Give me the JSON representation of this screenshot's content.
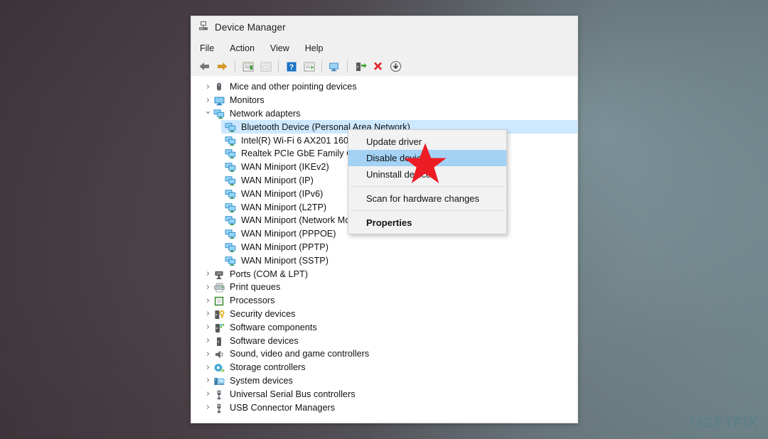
{
  "window": {
    "title": "Device Manager",
    "app_icon": "device-manager-icon",
    "menubar": [
      "File",
      "Action",
      "View",
      "Help"
    ],
    "toolbar": [
      {
        "name": "back-icon",
        "label": "Back"
      },
      {
        "name": "forward-icon",
        "label": "Forward"
      },
      {
        "name": "separator",
        "label": ""
      },
      {
        "name": "properties-icon",
        "label": "Properties"
      },
      {
        "name": "show-hidden-devices-icon",
        "label": "Show hidden devices"
      },
      {
        "name": "separator",
        "label": ""
      },
      {
        "name": "help-icon",
        "label": "Help"
      },
      {
        "name": "update-driver-icon",
        "label": "Update driver"
      },
      {
        "name": "scan-for-hardware-changes-icon",
        "label": "Scan for hardware changes"
      },
      {
        "name": "separator",
        "label": ""
      },
      {
        "name": "enable-device-icon",
        "label": "Enable device"
      },
      {
        "name": "uninstall-device-icon",
        "label": "Uninstall device"
      },
      {
        "name": "disable-device-icon",
        "label": "Disable device"
      }
    ]
  },
  "tree": [
    {
      "label": "Mice and other pointing devices",
      "icon": "mouse-icon",
      "state": "collapsed",
      "level": 1
    },
    {
      "label": "Monitors",
      "icon": "monitor-icon",
      "state": "collapsed",
      "level": 1
    },
    {
      "label": "Network adapters",
      "icon": "network-adapter-icon",
      "state": "expanded",
      "level": 1
    },
    {
      "label": "Bluetooth Device (Personal Area Network)",
      "icon": "network-adapter-icon",
      "state": "leaf",
      "level": 2,
      "selected": true
    },
    {
      "label": "Intel(R) Wi-Fi 6 AX201 160MHz",
      "icon": "network-adapter-icon",
      "state": "leaf",
      "level": 2
    },
    {
      "label": "Realtek PCIe GbE Family Controller",
      "icon": "network-adapter-icon",
      "state": "leaf",
      "level": 2
    },
    {
      "label": "WAN Miniport (IKEv2)",
      "icon": "network-adapter-icon",
      "state": "leaf",
      "level": 2
    },
    {
      "label": "WAN Miniport (IP)",
      "icon": "network-adapter-icon",
      "state": "leaf",
      "level": 2
    },
    {
      "label": "WAN Miniport (IPv6)",
      "icon": "network-adapter-icon",
      "state": "leaf",
      "level": 2
    },
    {
      "label": "WAN Miniport (L2TP)",
      "icon": "network-adapter-icon",
      "state": "leaf",
      "level": 2
    },
    {
      "label": "WAN Miniport (Network Monitor)",
      "icon": "network-adapter-icon",
      "state": "leaf",
      "level": 2
    },
    {
      "label": "WAN Miniport (PPPOE)",
      "icon": "network-adapter-icon",
      "state": "leaf",
      "level": 2
    },
    {
      "label": "WAN Miniport (PPTP)",
      "icon": "network-adapter-icon",
      "state": "leaf",
      "level": 2
    },
    {
      "label": "WAN Miniport (SSTP)",
      "icon": "network-adapter-icon",
      "state": "leaf",
      "level": 2
    },
    {
      "label": "Ports (COM & LPT)",
      "icon": "port-icon",
      "state": "collapsed",
      "level": 1
    },
    {
      "label": "Print queues",
      "icon": "printer-icon",
      "state": "collapsed",
      "level": 1
    },
    {
      "label": "Processors",
      "icon": "processor-icon",
      "state": "collapsed",
      "level": 1
    },
    {
      "label": "Security devices",
      "icon": "security-device-icon",
      "state": "collapsed",
      "level": 1
    },
    {
      "label": "Software components",
      "icon": "software-component-icon",
      "state": "collapsed",
      "level": 1
    },
    {
      "label": "Software devices",
      "icon": "software-device-icon",
      "state": "collapsed",
      "level": 1
    },
    {
      "label": "Sound, video and game controllers",
      "icon": "speaker-icon",
      "state": "collapsed",
      "level": 1
    },
    {
      "label": "Storage controllers",
      "icon": "storage-controller-icon",
      "state": "collapsed",
      "level": 1
    },
    {
      "label": "System devices",
      "icon": "system-device-icon",
      "state": "collapsed",
      "level": 1
    },
    {
      "label": "Universal Serial Bus controllers",
      "icon": "usb-icon",
      "state": "collapsed",
      "level": 1
    },
    {
      "label": "USB Connector Managers",
      "icon": "usb-icon",
      "state": "collapsed",
      "level": 1
    }
  ],
  "context_menu": {
    "items": [
      {
        "label": "Update driver",
        "highlighted": false,
        "bold": false
      },
      {
        "label": "Disable device",
        "highlighted": true,
        "bold": false
      },
      {
        "label": "Uninstall device",
        "highlighted": false,
        "bold": false
      },
      {
        "separator": true
      },
      {
        "label": "Scan for hardware changes",
        "highlighted": false,
        "bold": false
      },
      {
        "separator": true
      },
      {
        "label": "Properties",
        "highlighted": false,
        "bold": true
      }
    ]
  },
  "annotation": {
    "shape": "red-star",
    "color": "#ee1c25",
    "points_to": "Disable device"
  },
  "watermark": {
    "text_before": "UG",
    "text_mid": "E",
    "text_after": "TFIX",
    "full": "UGETFIX",
    "color": "#5d7f88"
  },
  "colors": {
    "selection_blue": "#cde8ff",
    "menu_highlight": "#a3d2f5",
    "star_red": "#ee1c25",
    "chrome_gray": "#f0f0f0"
  }
}
